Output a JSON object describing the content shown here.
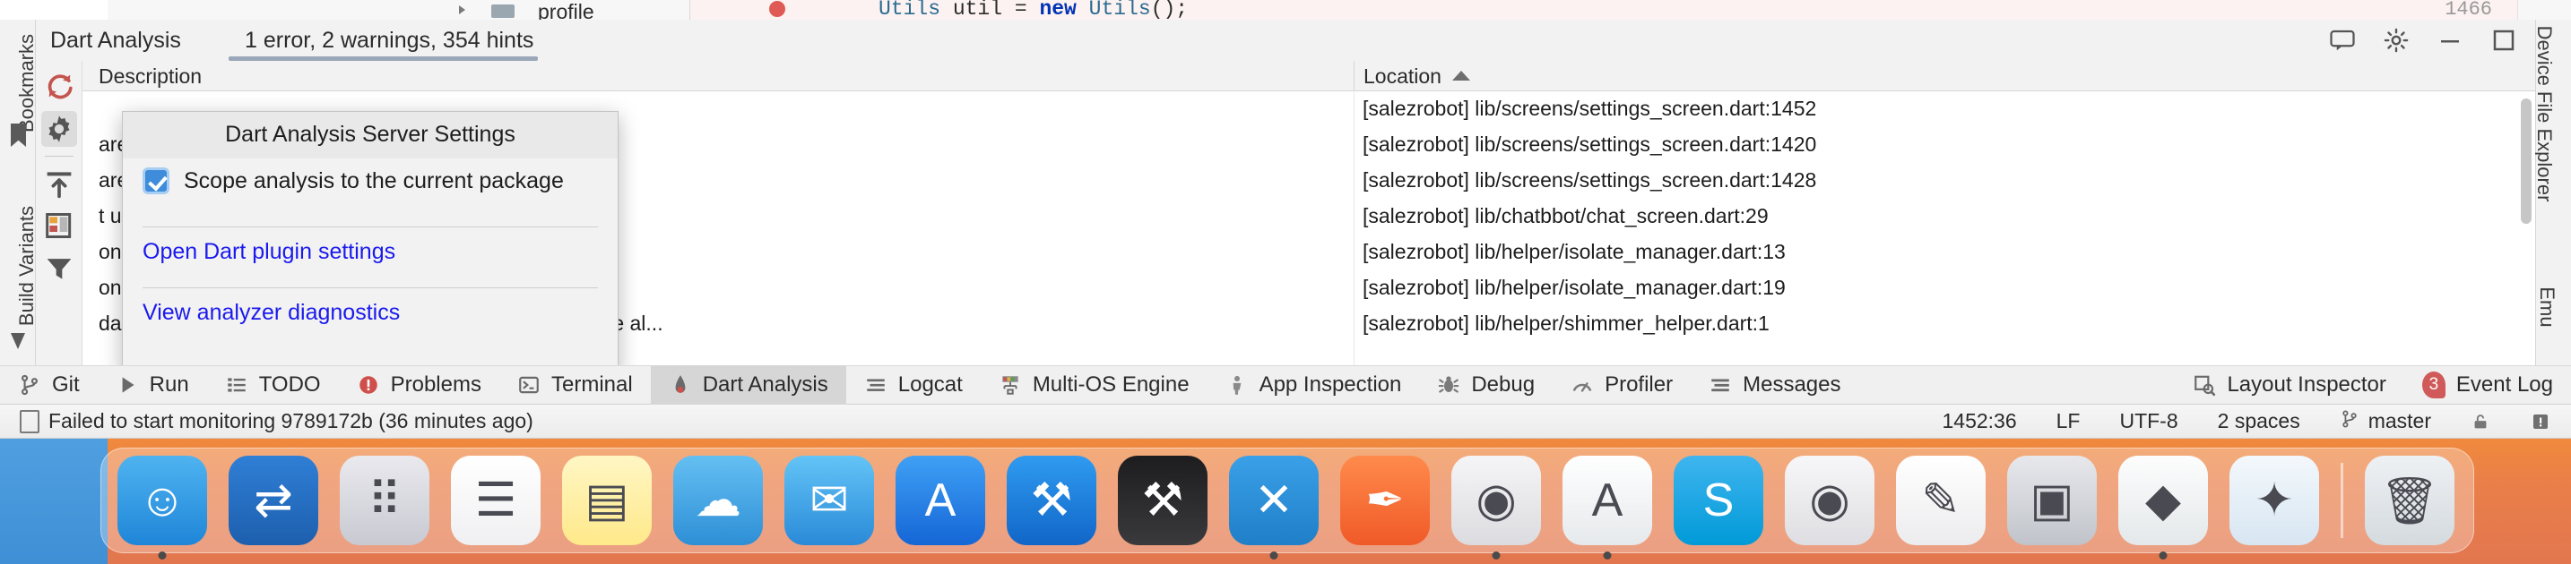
{
  "editor": {
    "project_node": "profile",
    "code_line": "Utils util = new Utils();",
    "line_number": "1466"
  },
  "left_strip": {
    "bookmarks_label": "Bookmarks",
    "build_variants_label": "Build Variants"
  },
  "right_strip": {
    "device_file_explorer_label": "Device File Explorer",
    "emulator_label": "Emu"
  },
  "tool_window": {
    "title": "Dart Analysis",
    "tab_label": "1 error, 2 warnings, 354 hints",
    "header_icons": [
      "comment-icon",
      "gear-icon",
      "minimize-icon",
      "close-icon"
    ],
    "gutter_actions": [
      "refresh-icon",
      "settings-gear-icon",
      "expand-all-icon",
      "group-by-icon",
      "filter-icon"
    ]
  },
  "table": {
    "columns": {
      "description": "Description",
      "location": "Location"
    },
    "sort": {
      "column": "Location",
      "direction": "asc"
    },
    "rows": [
      {
        "description": "",
        "location": "[salezrobot] lib/screens/settings_screen.dart:1452"
      },
      {
        "description": "are operator '?.' is unnecessary.",
        "location": "[salezrobot] lib/screens/settings_screen.dart:1420"
      },
      {
        "description": "are operator '?.' is unnecessary.",
        "location": "[salezrobot] lib/screens/settings_screen.dart:1428"
      },
      {
        "description": "t used.",
        "location": "[salezrobot] lib/chatbbot/chat_screen.dart:29"
      },
      {
        "description": "on is always true.",
        "location": "[salezrobot] lib/helper/isolate_manager.dart:13"
      },
      {
        "description": "on is always true.",
        "location": "[salezrobot] lib/helper/isolate_manager.dart:19"
      },
      {
        "description": "dart' is unnecessary because all of the used elements are al...",
        "location": "[salezrobot] lib/helper/shimmer_helper.dart:1"
      }
    ]
  },
  "popup": {
    "title": "Dart Analysis Server Settings",
    "checkbox_label": "Scope analysis to the current package",
    "checkbox_checked": true,
    "links": [
      "Open Dart plugin settings",
      "View analyzer diagnostics"
    ],
    "link_color": "#1a1aee"
  },
  "bottom_tabs": [
    {
      "label": "Git",
      "icon": "branch-icon",
      "selected": false
    },
    {
      "label": "Run",
      "icon": "play-icon",
      "selected": false
    },
    {
      "label": "TODO",
      "icon": "list-icon",
      "selected": false
    },
    {
      "label": "Problems",
      "icon": "error-circle-icon",
      "selected": false
    },
    {
      "label": "Terminal",
      "icon": "terminal-icon",
      "selected": false
    },
    {
      "label": "Dart Analysis",
      "icon": "dart-icon",
      "selected": true
    },
    {
      "label": "Logcat",
      "icon": "logcat-icon",
      "selected": false
    },
    {
      "label": "Multi-OS Engine",
      "icon": "multios-icon",
      "selected": false
    },
    {
      "label": "App Inspection",
      "icon": "inspection-icon",
      "selected": false
    },
    {
      "label": "Debug",
      "icon": "bug-icon",
      "selected": false
    },
    {
      "label": "Profiler",
      "icon": "profiler-icon",
      "selected": false
    },
    {
      "label": "Messages",
      "icon": "messages-icon",
      "selected": false
    }
  ],
  "bottom_tabs_right": [
    {
      "label": "Layout Inspector",
      "icon": "layout-inspector-icon",
      "badge": ""
    },
    {
      "label": "Event Log",
      "icon": "event-log-icon",
      "badge": "3"
    }
  ],
  "status_bar": {
    "message": "Failed to start monitoring 9789172b (36 minutes ago)",
    "caret_position": "1452:36",
    "line_separator": "LF",
    "encoding": "UTF-8",
    "indent": "2 spaces",
    "branch": "master"
  },
  "dock": {
    "items": [
      {
        "name": "finder",
        "glyph": "☺",
        "bg": "linear-gradient(180deg,#4fb3f0,#1f86d8)",
        "running": true
      },
      {
        "name": "migration-assistant",
        "glyph": "⇄",
        "bg": "linear-gradient(180deg,#2f7fd6,#1d5fae)",
        "running": false
      },
      {
        "name": "launchpad",
        "glyph": "⠿",
        "bg": "linear-gradient(180deg,#e9e9ee,#c9c9d2)",
        "running": false
      },
      {
        "name": "reminders",
        "glyph": "☰",
        "bg": "linear-gradient(180deg,#ffffff,#f0f0f2)",
        "running": false
      },
      {
        "name": "notes",
        "glyph": "▤",
        "bg": "linear-gradient(180deg,#fff6c4,#ffe98a)",
        "running": false
      },
      {
        "name": "weather",
        "glyph": "☁",
        "bg": "linear-gradient(180deg,#64bff2,#2e8fd6)",
        "running": false
      },
      {
        "name": "mail",
        "glyph": "✉",
        "bg": "linear-gradient(180deg,#63c4f7,#2a8ad8)",
        "running": false
      },
      {
        "name": "app-store",
        "glyph": "A",
        "bg": "linear-gradient(180deg,#3fa0f5,#1566d6)",
        "running": false
      },
      {
        "name": "xcode",
        "glyph": "⚒",
        "bg": "linear-gradient(180deg,#2f9bf0,#1166c8)",
        "running": false
      },
      {
        "name": "xcode-beta",
        "glyph": "⚒",
        "bg": "linear-gradient(180deg,#1d1d1f,#3a3a3c)",
        "running": false
      },
      {
        "name": "vs-code",
        "glyph": "✕",
        "bg": "linear-gradient(180deg,#3aa0e8,#1f7fc8)",
        "running": true
      },
      {
        "name": "postman",
        "glyph": "✒",
        "bg": "linear-gradient(180deg,#ff8a4c,#f05a28)",
        "running": false
      },
      {
        "name": "google-chrome",
        "glyph": "◉",
        "bg": "linear-gradient(180deg,#f5f5f7,#dcdce0)",
        "running": true
      },
      {
        "name": "android-studio",
        "glyph": "A",
        "bg": "linear-gradient(180deg,#ffffff,#e6e9ec)",
        "running": true
      },
      {
        "name": "skype",
        "glyph": "S",
        "bg": "linear-gradient(180deg,#3fb5ef,#009ad8)",
        "running": false
      },
      {
        "name": "chrome-canary",
        "glyph": "◉",
        "bg": "linear-gradient(180deg,#f7f7f9,#dedee2)",
        "running": false
      },
      {
        "name": "text-editor",
        "glyph": "✎",
        "bg": "linear-gradient(180deg,#ffffff,#ececee)",
        "running": false
      },
      {
        "name": "screenshot-tool",
        "glyph": "▣",
        "bg": "linear-gradient(180deg,#e8e8ec,#c0c4ca)",
        "running": false
      },
      {
        "name": "sublime-text",
        "glyph": "◆",
        "bg": "linear-gradient(180deg,#fdfdfd,#e4e8ea)",
        "running": true
      },
      {
        "name": "safari",
        "glyph": "✦",
        "bg": "linear-gradient(180deg,#f3f8fc,#d8e6f2)",
        "running": false
      },
      {
        "name": "trash",
        "glyph": "🗑",
        "bg": "linear-gradient(180deg,#eef1f4,#d4dade)",
        "running": false
      }
    ]
  }
}
